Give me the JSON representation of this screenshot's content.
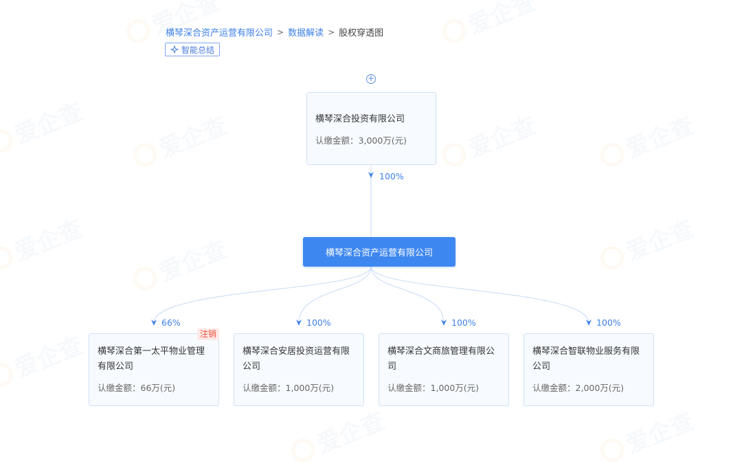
{
  "watermark": "爱企查",
  "breadcrumb": {
    "company": "横琴深合资产运营有限公司",
    "section": "数据解读",
    "current": "股权穿透图",
    "separator": ">"
  },
  "summary_button": {
    "label": "智能总结"
  },
  "expand_button": {
    "symbol": "+"
  },
  "shareholder": {
    "name": "横琴深合投资有限公司",
    "amount_label": "认缴金额：",
    "amount": "3,000万(元)",
    "percent": "100%"
  },
  "center": {
    "name": "横琴深合资产运营有限公司"
  },
  "subsidiaries": [
    {
      "name": "横琴深合第一太平物业管理有限公司",
      "amount_label": "认缴金额：",
      "amount": "66万(元)",
      "percent": "66%",
      "tag": "注销"
    },
    {
      "name": "横琴深合安居投资运营有限公司",
      "amount_label": "认缴金额：",
      "amount": "1,000万(元)",
      "percent": "100%",
      "tag": ""
    },
    {
      "name": "横琴深合文商旅管理有限公司",
      "amount_label": "认缴金额：",
      "amount": "1,000万(元)",
      "percent": "100%",
      "tag": ""
    },
    {
      "name": "横琴深合智联物业服务有限公司",
      "amount_label": "认缴金额：",
      "amount": "2,000万(元)",
      "percent": "100%",
      "tag": ""
    }
  ],
  "colors": {
    "accent": "#3d87f0",
    "link": "#3e80e6",
    "node_bg": "#f7fbff",
    "node_border": "#cfe0f7",
    "cancel": "#e8513e"
  }
}
